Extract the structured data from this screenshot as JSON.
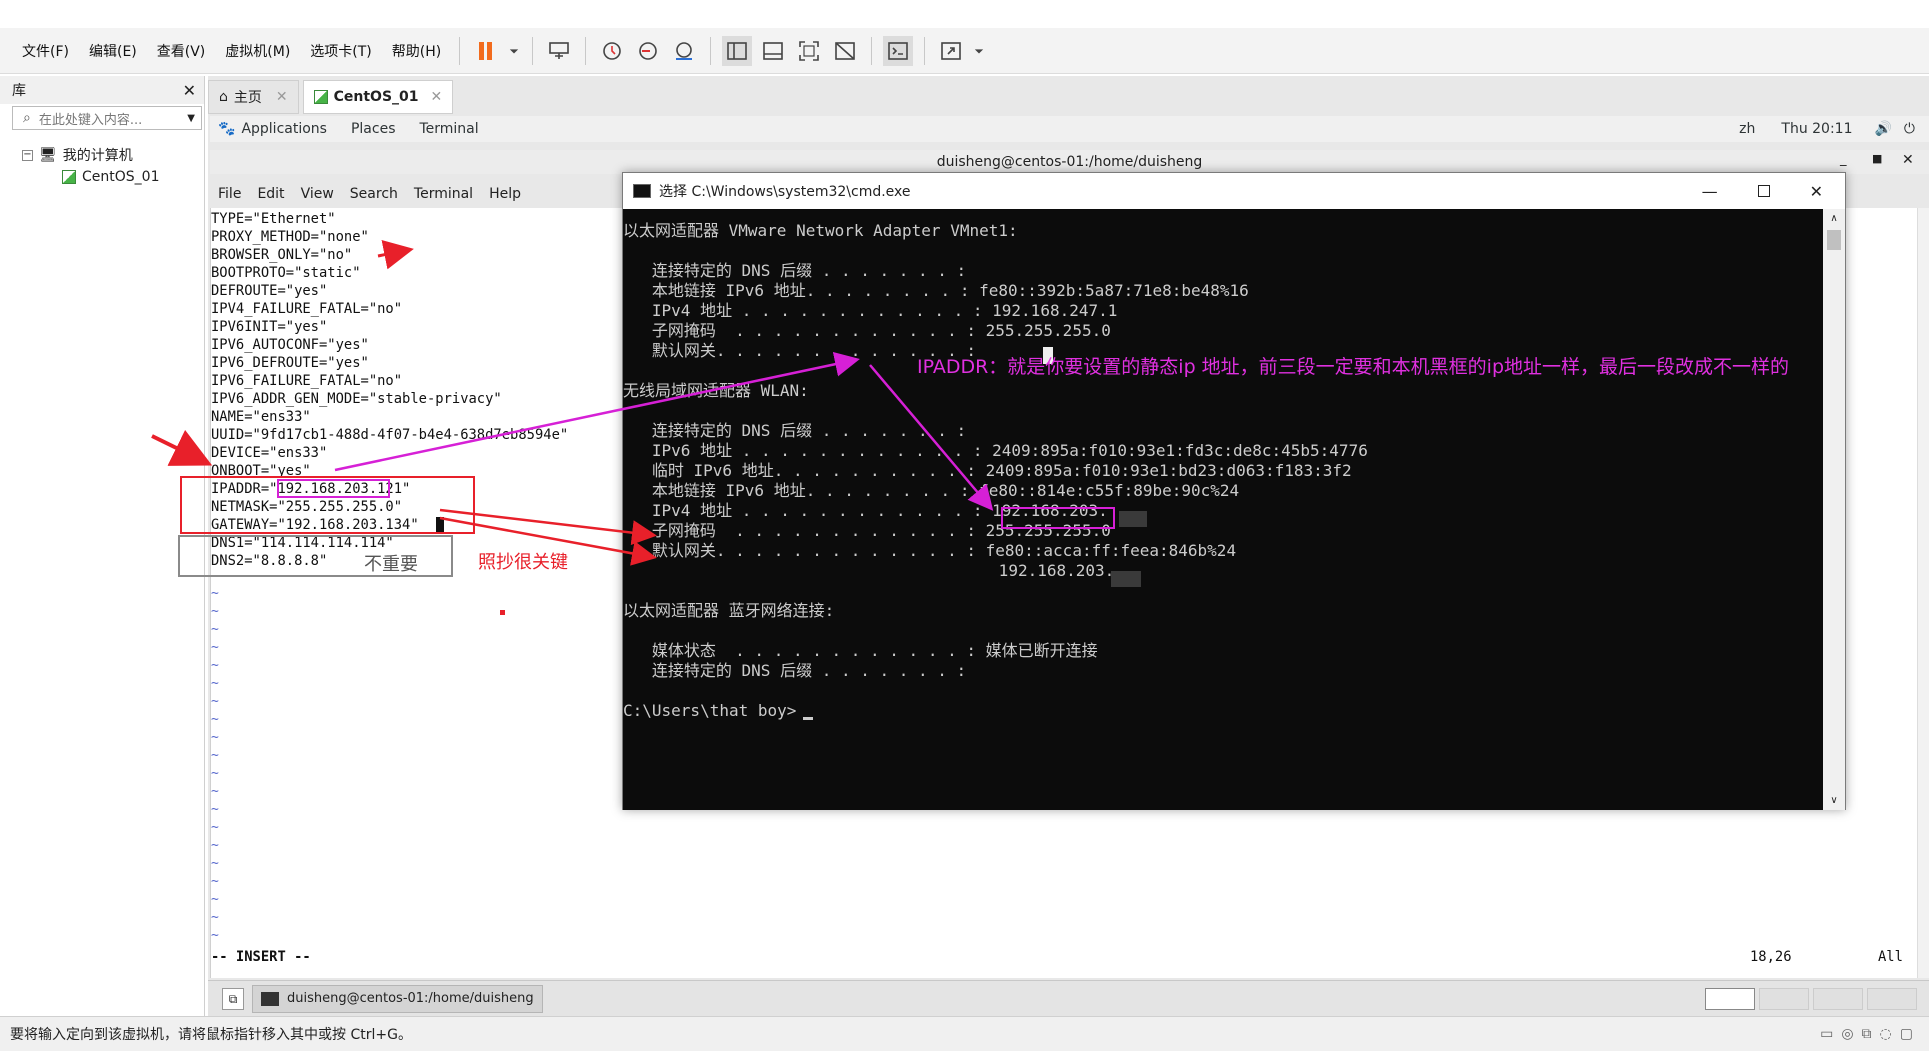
{
  "menubar": {
    "items": [
      "文件(F)",
      "编辑(E)",
      "查看(V)",
      "虚拟机(M)",
      "选项卡(T)",
      "帮助(H)"
    ]
  },
  "library": {
    "title": "库",
    "search_placeholder": "在此处键入内容...",
    "tree": {
      "root": "我的计算机",
      "child": "CentOS_01"
    }
  },
  "tabs": [
    {
      "label": "主页",
      "icon": "home-icon"
    },
    {
      "label": "CentOS_01",
      "icon": "vm-icon"
    }
  ],
  "gnome": {
    "applications": "Applications",
    "places": "Places",
    "terminal": "Terminal",
    "lang": "zh",
    "clock": "Thu 20:11"
  },
  "terminal": {
    "title": "duisheng@centos-01:/home/duisheng",
    "menu": [
      "File",
      "Edit",
      "View",
      "Search",
      "Terminal",
      "Help"
    ],
    "lines": [
      "TYPE=\"Ethernet\"",
      "PROXY_METHOD=\"none\"",
      "BROWSER_ONLY=\"no\"",
      "BOOTPROTO=\"static\"",
      "DEFROUTE=\"yes\"",
      "IPV4_FAILURE_FATAL=\"no\"",
      "IPV6INIT=\"yes\"",
      "IPV6_AUTOCONF=\"yes\"",
      "IPV6_DEFROUTE=\"yes\"",
      "IPV6_FAILURE_FATAL=\"no\"",
      "IPV6_ADDR_GEN_MODE=\"stable-privacy\"",
      "NAME=\"ens33\"",
      "UUID=\"9fd17cb1-488d-4f07-b4e4-638d7eb8594e\"",
      "DEVICE=\"ens33\"",
      "ONBOOT=\"yes\"",
      "IPADDR=\"192.168.203.121\"",
      "NETMASK=\"255.255.255.0\"",
      "GATEWAY=\"192.168.203.134\"",
      "DNS1=\"114.114.114.114\"",
      "DNS2=\"8.8.8.8\""
    ],
    "mode": "-- INSERT --",
    "position": "18,26",
    "scroll": "All"
  },
  "cmd": {
    "title": "选择 C:\\Windows\\system32\\cmd.exe",
    "lines": [
      "以太网适配器 VMware Network Adapter VMnet1:",
      "",
      "   连接特定的 DNS 后缀 . . . . . . . :",
      "   本地链接 IPv6 地址. . . . . . . . : fe80::392b:5a87:71e8:be48%16",
      "   IPv4 地址 . . . . . . . . . . . . : 192.168.247.1",
      "   子网掩码  . . . . . . . . . . . . : 255.255.255.0",
      "   默认网关. . . . . . . . . . . . . :",
      "",
      "无线局域网适配器 WLAN:",
      "",
      "   连接特定的 DNS 后缀 . . . . . . . :",
      "   IPv6 地址 . . . . . . . . . . . . : 2409:895a:f010:93e1:fd3c:de8c:45b5:4776",
      "   临时 IPv6 地址. . . . . . . . . . : 2409:895a:f010:93e1:bd23:d063:f183:3f2",
      "   本地链接 IPv6 地址. . . . . . . . : fe80::814e:c55f:89be:90c%24",
      "   IPv4 地址 . . . . . . . . . . . . : 192.168.203.",
      "   子网掩码  . . . . . . . . . . . . : 255.255.255.0",
      "   默认网关. . . . . . . . . . . . . : fe80::acca:ff:feea:846b%24",
      "                                       192.168.203.",
      "",
      "以太网适配器 蓝牙网络连接:",
      "",
      "   媒体状态  . . . . . . . . . . . . : 媒体已断开连接",
      "   连接特定的 DNS 后缀 . . . . . . . :",
      "",
      "C:\\Users\\that boy>"
    ]
  },
  "annotations": {
    "ipaddr_note": "IPADDR：就是你要设置的静态ip 地址，前三段一定要和本机黑框的ip地址一样，最后一段改成不一样的",
    "copy_note": "照抄很关键",
    "not_important": "不重要"
  },
  "bottom": {
    "task": "duisheng@centos-01:/home/duisheng"
  },
  "status": {
    "text": "要将输入定向到该虚拟机，请将鼠标指针移入其中或按 Ctrl+G。"
  },
  "colors": {
    "annot_red": "#e8202a",
    "annot_magenta": "#d620d6",
    "pause_orange": "#f26b1d"
  }
}
